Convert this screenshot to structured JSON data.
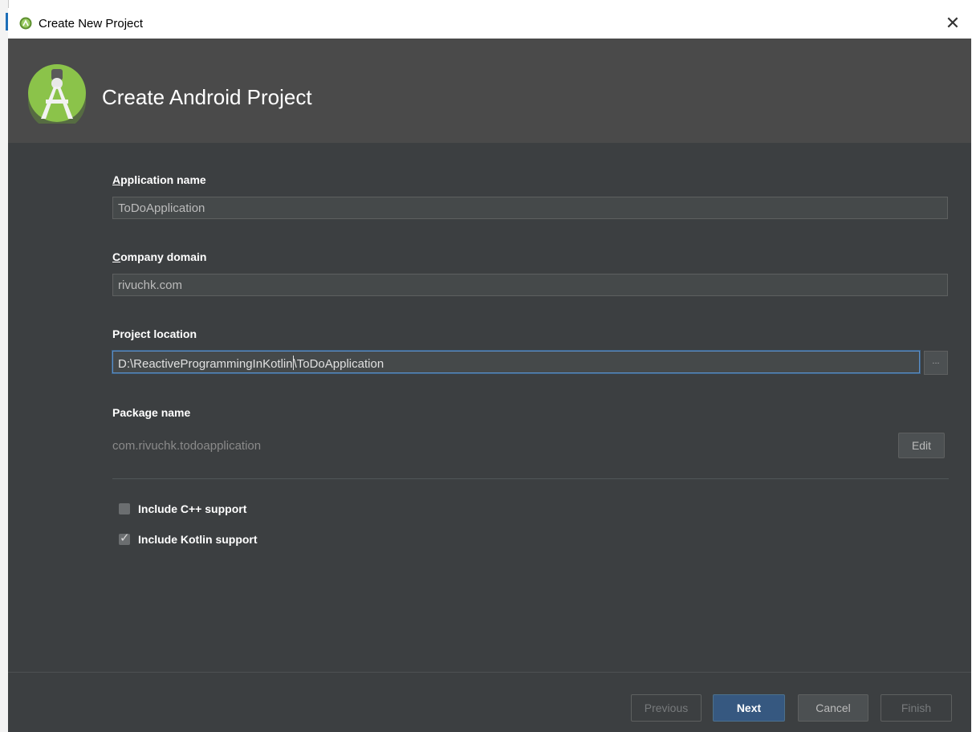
{
  "window": {
    "title": "Create New Project",
    "close_glyph": "✕"
  },
  "header": {
    "title": "Create Android Project",
    "logo_icon": "android-studio-logo-icon"
  },
  "form": {
    "app_name": {
      "label_accel": "A",
      "label_rest": "pplication name",
      "value": "ToDoApplication"
    },
    "company_domain": {
      "label_accel": "C",
      "label_rest": "ompany domain",
      "value": "rivuchk.com"
    },
    "project_location": {
      "label": "Project location",
      "value_before_caret": "D:\\ReactiveProgrammingInKotlin",
      "value_after_caret": "\\ToDoApplication",
      "browse_label": "..."
    },
    "package_name": {
      "label": "Package name",
      "value": "com.rivuchk.todoapplication",
      "edit_label": "Edit"
    },
    "options": [
      {
        "label": "Include C++ support",
        "checked": false
      },
      {
        "label": "Include Kotlin support",
        "checked": true
      }
    ]
  },
  "footer": {
    "previous_label": "Previous",
    "next_label": "Next",
    "cancel_label": "Cancel",
    "finish_label": "Finish"
  },
  "colors": {
    "background": "#3c3f41",
    "header_bg": "#4a4a4a",
    "accent_button": "#365880",
    "android_green": "#8bc34a"
  }
}
